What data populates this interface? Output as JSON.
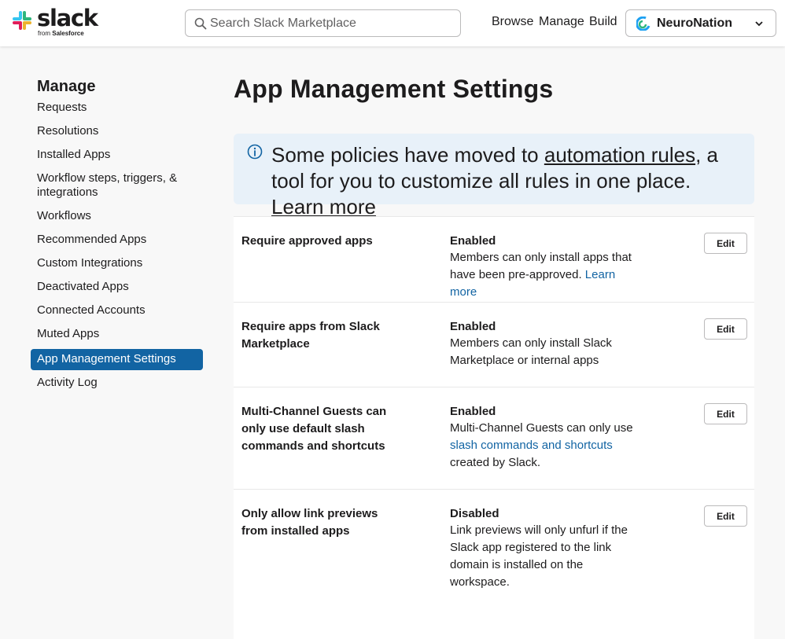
{
  "header": {
    "logo_text": "slack",
    "logo_sub_prefix": "from",
    "logo_sub_brand": "Salesforce",
    "search_placeholder": "Search Slack Marketplace",
    "nav": [
      "Browse",
      "Manage",
      "Build"
    ],
    "workspace": "NeuroNation"
  },
  "sidebar": {
    "title": "Manage",
    "items": [
      {
        "label": "Requests",
        "active": false
      },
      {
        "label": "Resolutions",
        "active": false
      },
      {
        "label": "Installed Apps",
        "active": false
      },
      {
        "label": "Workflow steps, triggers, & integrations",
        "active": false
      },
      {
        "label": "Workflows",
        "active": false
      },
      {
        "label": "Recommended Apps",
        "active": false
      },
      {
        "label": "Custom Integrations",
        "active": false
      },
      {
        "label": "Deactivated Apps",
        "active": false
      },
      {
        "label": "Connected Accounts",
        "active": false
      },
      {
        "label": "Muted Apps",
        "active": false
      },
      {
        "label": "App Management Settings",
        "active": true
      },
      {
        "label": "Activity Log",
        "active": false
      }
    ]
  },
  "main": {
    "title": "App Management Settings",
    "banner": {
      "text_before": "Some policies have moved to ",
      "link1": "automation rules",
      "text_after": ", a tool for you to customize all rules in one place.",
      "link2": "Learn more"
    },
    "settings": [
      {
        "name": "Require approved apps",
        "status": "Enabled",
        "desc_before": "Members can only install apps that have been pre-approved.",
        "desc_link": "Learn more",
        "desc_after": "",
        "edit_label": "Edit"
      },
      {
        "name": "Require apps from Slack Marketplace",
        "status": "Enabled",
        "desc_before": "Members can only install Slack Marketplace or internal apps",
        "desc_link": "",
        "desc_after": "",
        "edit_label": "Edit"
      },
      {
        "name": "Multi-Channel Guests can only use default slash commands and shortcuts",
        "status": "Enabled",
        "desc_before": "Multi-Channel Guests can only use",
        "desc_link": "slash commands and shortcuts",
        "desc_after": "created by Slack.",
        "edit_label": "Edit"
      },
      {
        "name": "Only allow link previews from installed apps",
        "status": "Disabled",
        "desc_before": "Link previews will only unfurl if the Slack app registered to the link domain is installed on the workspace.",
        "desc_link": "",
        "desc_after": "",
        "edit_label": "Edit"
      }
    ]
  },
  "colors": {
    "accent": "#1264a3",
    "banner_bg": "#e8f1f9",
    "text": "#1d1c1d"
  },
  "icons": [
    "slack-logo-icon",
    "search-icon",
    "workspace-logo-icon",
    "chevron-down-icon",
    "info-icon"
  ]
}
